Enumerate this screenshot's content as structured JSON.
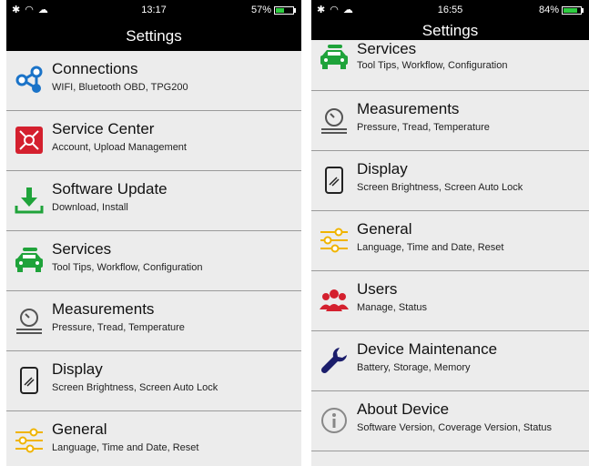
{
  "left": {
    "status": {
      "time": "13:17",
      "battery": "57%",
      "battery_level": 0.57
    },
    "title": "Settings",
    "items": [
      {
        "title": "Connections",
        "sub": "WIFI, Bluetooth OBD, TPG200",
        "icon": "connections-icon"
      },
      {
        "title": "Service Center",
        "sub": "Account, Upload Management",
        "icon": "service-center-icon"
      },
      {
        "title": "Software Update",
        "sub": "Download, Install",
        "icon": "download-icon"
      },
      {
        "title": "Services",
        "sub": "Tool Tips, Workflow, Configuration",
        "icon": "car-service-icon"
      },
      {
        "title": "Measurements",
        "sub": "Pressure, Tread, Temperature",
        "icon": "gauge-icon"
      },
      {
        "title": "Display",
        "sub": "Screen Brightness, Screen Auto Lock",
        "icon": "display-icon"
      },
      {
        "title": "General",
        "sub": "Language, Time and Date, Reset",
        "icon": "sliders-icon"
      }
    ]
  },
  "right": {
    "status": {
      "time": "16:55",
      "battery": "84%",
      "battery_level": 0.84
    },
    "title": "Settings",
    "items": [
      {
        "title": "Services",
        "sub": "Tool Tips, Workflow, Configuration",
        "icon": "car-service-icon"
      },
      {
        "title": "Measurements",
        "sub": "Pressure, Tread, Temperature",
        "icon": "gauge-icon"
      },
      {
        "title": "Display",
        "sub": "Screen Brightness, Screen Auto Lock",
        "icon": "display-icon"
      },
      {
        "title": "General",
        "sub": "Language, Time and Date, Reset",
        "icon": "sliders-icon"
      },
      {
        "title": "Users",
        "sub": "Manage, Status",
        "icon": "users-icon"
      },
      {
        "title": "Device Maintenance",
        "sub": "Battery, Storage, Memory",
        "icon": "wrench-icon"
      },
      {
        "title": "About Device",
        "sub": "Software Version, Coverage Version, Status",
        "icon": "info-icon"
      }
    ]
  },
  "colors": {
    "blue": "#1a73c8",
    "red": "#d4202e",
    "green": "#1fa33a",
    "yellow": "#f0b400",
    "purple": "#1b1d6b",
    "grey": "#555555"
  }
}
